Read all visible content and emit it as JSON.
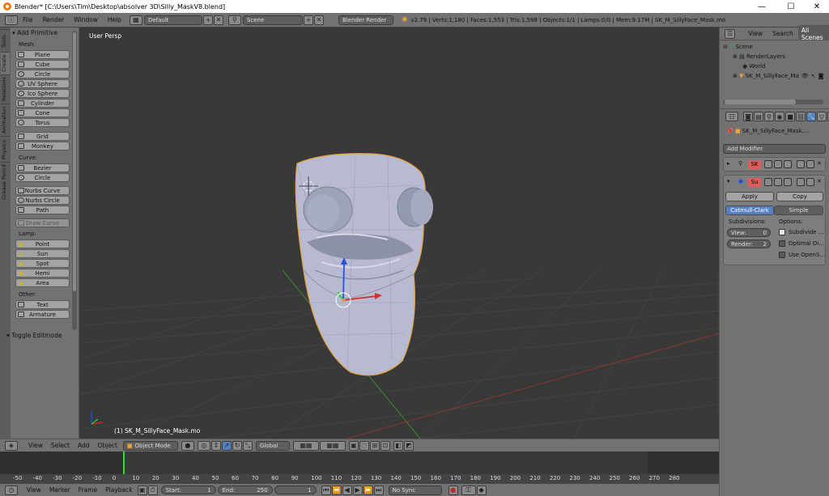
{
  "window": {
    "title": "Blender* [C:\\Users\\Tim\\Desktop\\absolver 3D\\Silly_MaskV8.blend]",
    "minimize": "—",
    "maximize": "☐",
    "close": "✕"
  },
  "info_header": {
    "menus": [
      "File",
      "Render",
      "Window",
      "Help"
    ],
    "layout": "Default",
    "scene": "Scene",
    "engine": "Blender Render",
    "stats": "v2.79 | Verts:1,180 | Faces:1,553 | Tris:1,598 | Objects:1/1 | Lamps:0/0 | Mem:9.17M | SK_M_SillyFace_Mask.mo"
  },
  "tool_tabs": [
    "Tools",
    "Create",
    "Relations",
    "Animation",
    "Physics",
    "Grease Pencil"
  ],
  "tools": {
    "panel_title": "Add Primitive",
    "mesh_label": "Mesh:",
    "mesh": [
      "Plane",
      "Cube",
      "Circle",
      "UV Sphere",
      "Ico Sphere",
      "Cylinder",
      "Cone",
      "Torus"
    ],
    "mesh2": [
      "Grid",
      "Monkey"
    ],
    "curve_label": "Curve:",
    "curve": [
      "Bezier",
      "Circle"
    ],
    "curve2": [
      "Nurbs Curve",
      "Nurbs Circle",
      "Path"
    ],
    "draw_curve": "Draw Curve",
    "lamp_label": "Lamp:",
    "lamp": [
      "Point",
      "Sun",
      "Spot",
      "Hemi",
      "Area"
    ],
    "other_label": "Other:",
    "other": [
      "Text",
      "Armature"
    ],
    "toggle_editmode": "Toggle Editmode"
  },
  "viewport": {
    "label": "User Persp",
    "object_label": "(1) SK_M_SillyFace_Mask.mo"
  },
  "view_header": {
    "menus": [
      "View",
      "Select",
      "Add",
      "Object"
    ],
    "mode": "Object Mode",
    "orientation": "Global"
  },
  "timeline": {
    "ticks": [
      "-50",
      "-40",
      "-30",
      "-20",
      "-10",
      "0",
      "10",
      "20",
      "30",
      "40",
      "50",
      "60",
      "70",
      "80",
      "90",
      "100",
      "110",
      "120",
      "130",
      "140",
      "150",
      "160",
      "170",
      "180",
      "190",
      "200",
      "210",
      "220",
      "230",
      "240",
      "250",
      "260",
      "270",
      "280"
    ],
    "menus": [
      "View",
      "Marker",
      "Frame",
      "Playback"
    ],
    "start_label": "Start:",
    "start": "1",
    "end_label": "End:",
    "end": "250",
    "current": "1",
    "sync": "No Sync"
  },
  "outliner": {
    "menus": [
      "View",
      "Search"
    ],
    "scenes": "All Scenes",
    "items": [
      "Scene",
      "RenderLayers",
      "World",
      "SK_M_SillyFace_Ma"
    ]
  },
  "properties": {
    "object_name": "SK_M_SillyFace_Mask....",
    "add_modifier": "Add Modifier",
    "mod1_badge": "SK",
    "mod2_badge": "Su",
    "apply": "Apply",
    "copy": "Copy",
    "catmull": "Catmull-Clark",
    "simple": "Simple",
    "subdivisions_label": "Subdivisions:",
    "options_label": "Options:",
    "view_label": "View:",
    "view_value": "0",
    "render_label": "Render:",
    "render_value": "2",
    "opt1": "Subdivide ...",
    "opt2": "Optimal Di...",
    "opt3": "Use OpenS..."
  },
  "colors": {
    "accent": "#5680c2",
    "selected_outline": "#e8a33d",
    "mesh": "#b9bcd1"
  }
}
